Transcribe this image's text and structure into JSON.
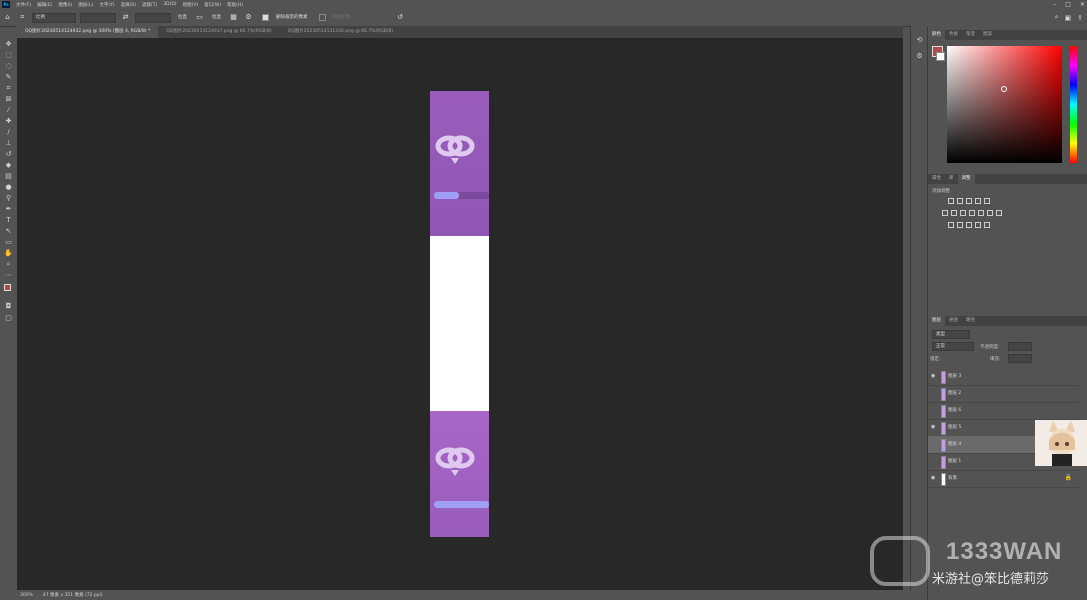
{
  "menubar": {
    "logo": "Ps",
    "items": [
      "文件(F)",
      "编辑(E)",
      "图像(I)",
      "图层(L)",
      "文字(Y)",
      "选择(S)",
      "滤镜(T)",
      "3D(D)",
      "视图(V)",
      "窗口(W)",
      "帮助(H)"
    ]
  },
  "options": {
    "ratio_select": "比例",
    "straighten_label": "拉直",
    "grid_label": "拉直",
    "delete_cropped_label": "删除裁剪的像素",
    "content_aware_label": "内容识别"
  },
  "tabs": [
    {
      "label": "QQ图片20230514124932.png @ 300% (图层 4, RGB/8) *",
      "active": true
    },
    {
      "label": "QQ图片20230514124937.png @ 66.7%(RGB/8)",
      "active": false
    },
    {
      "label": "QQ图片20230514131336.png @ 66.7%(RGB/8)",
      "active": false
    }
  ],
  "panels": {
    "color_tabs": [
      "颜色",
      "色板",
      "渐变",
      "图案"
    ],
    "adjust_tabs": [
      "属性",
      "库",
      "调整"
    ],
    "adjust_title": "添加调整",
    "layers_tabs": [
      "图层",
      "通道",
      "路径"
    ],
    "layer_kind": "类型",
    "blend_mode": "正常",
    "opacity_label": "不透明度:",
    "lock_label": "锁定:",
    "fill_label": "填充:"
  },
  "layers": [
    {
      "name": "图层 3",
      "visible": true
    },
    {
      "name": "图层 2",
      "visible": false
    },
    {
      "name": "图层 6",
      "visible": false
    },
    {
      "name": "图层 5",
      "visible": true
    },
    {
      "name": "图层 4",
      "visible": false,
      "selected": true
    },
    {
      "name": "图层 1",
      "visible": false
    },
    {
      "name": "背景",
      "visible": true,
      "locked": true
    }
  ],
  "status": {
    "zoom": "300%",
    "doc_info": "47 像素 x 351 像素 (72 ppi)"
  },
  "watermark": {
    "brand": "1333WAN",
    "caption": "米游社@笨比德莉莎"
  },
  "colors": {
    "foreground": "#b14a4a",
    "background": "#ffffff",
    "strip_purple": "#9a5dbb",
    "bar_fill": "#9f9ff5"
  }
}
